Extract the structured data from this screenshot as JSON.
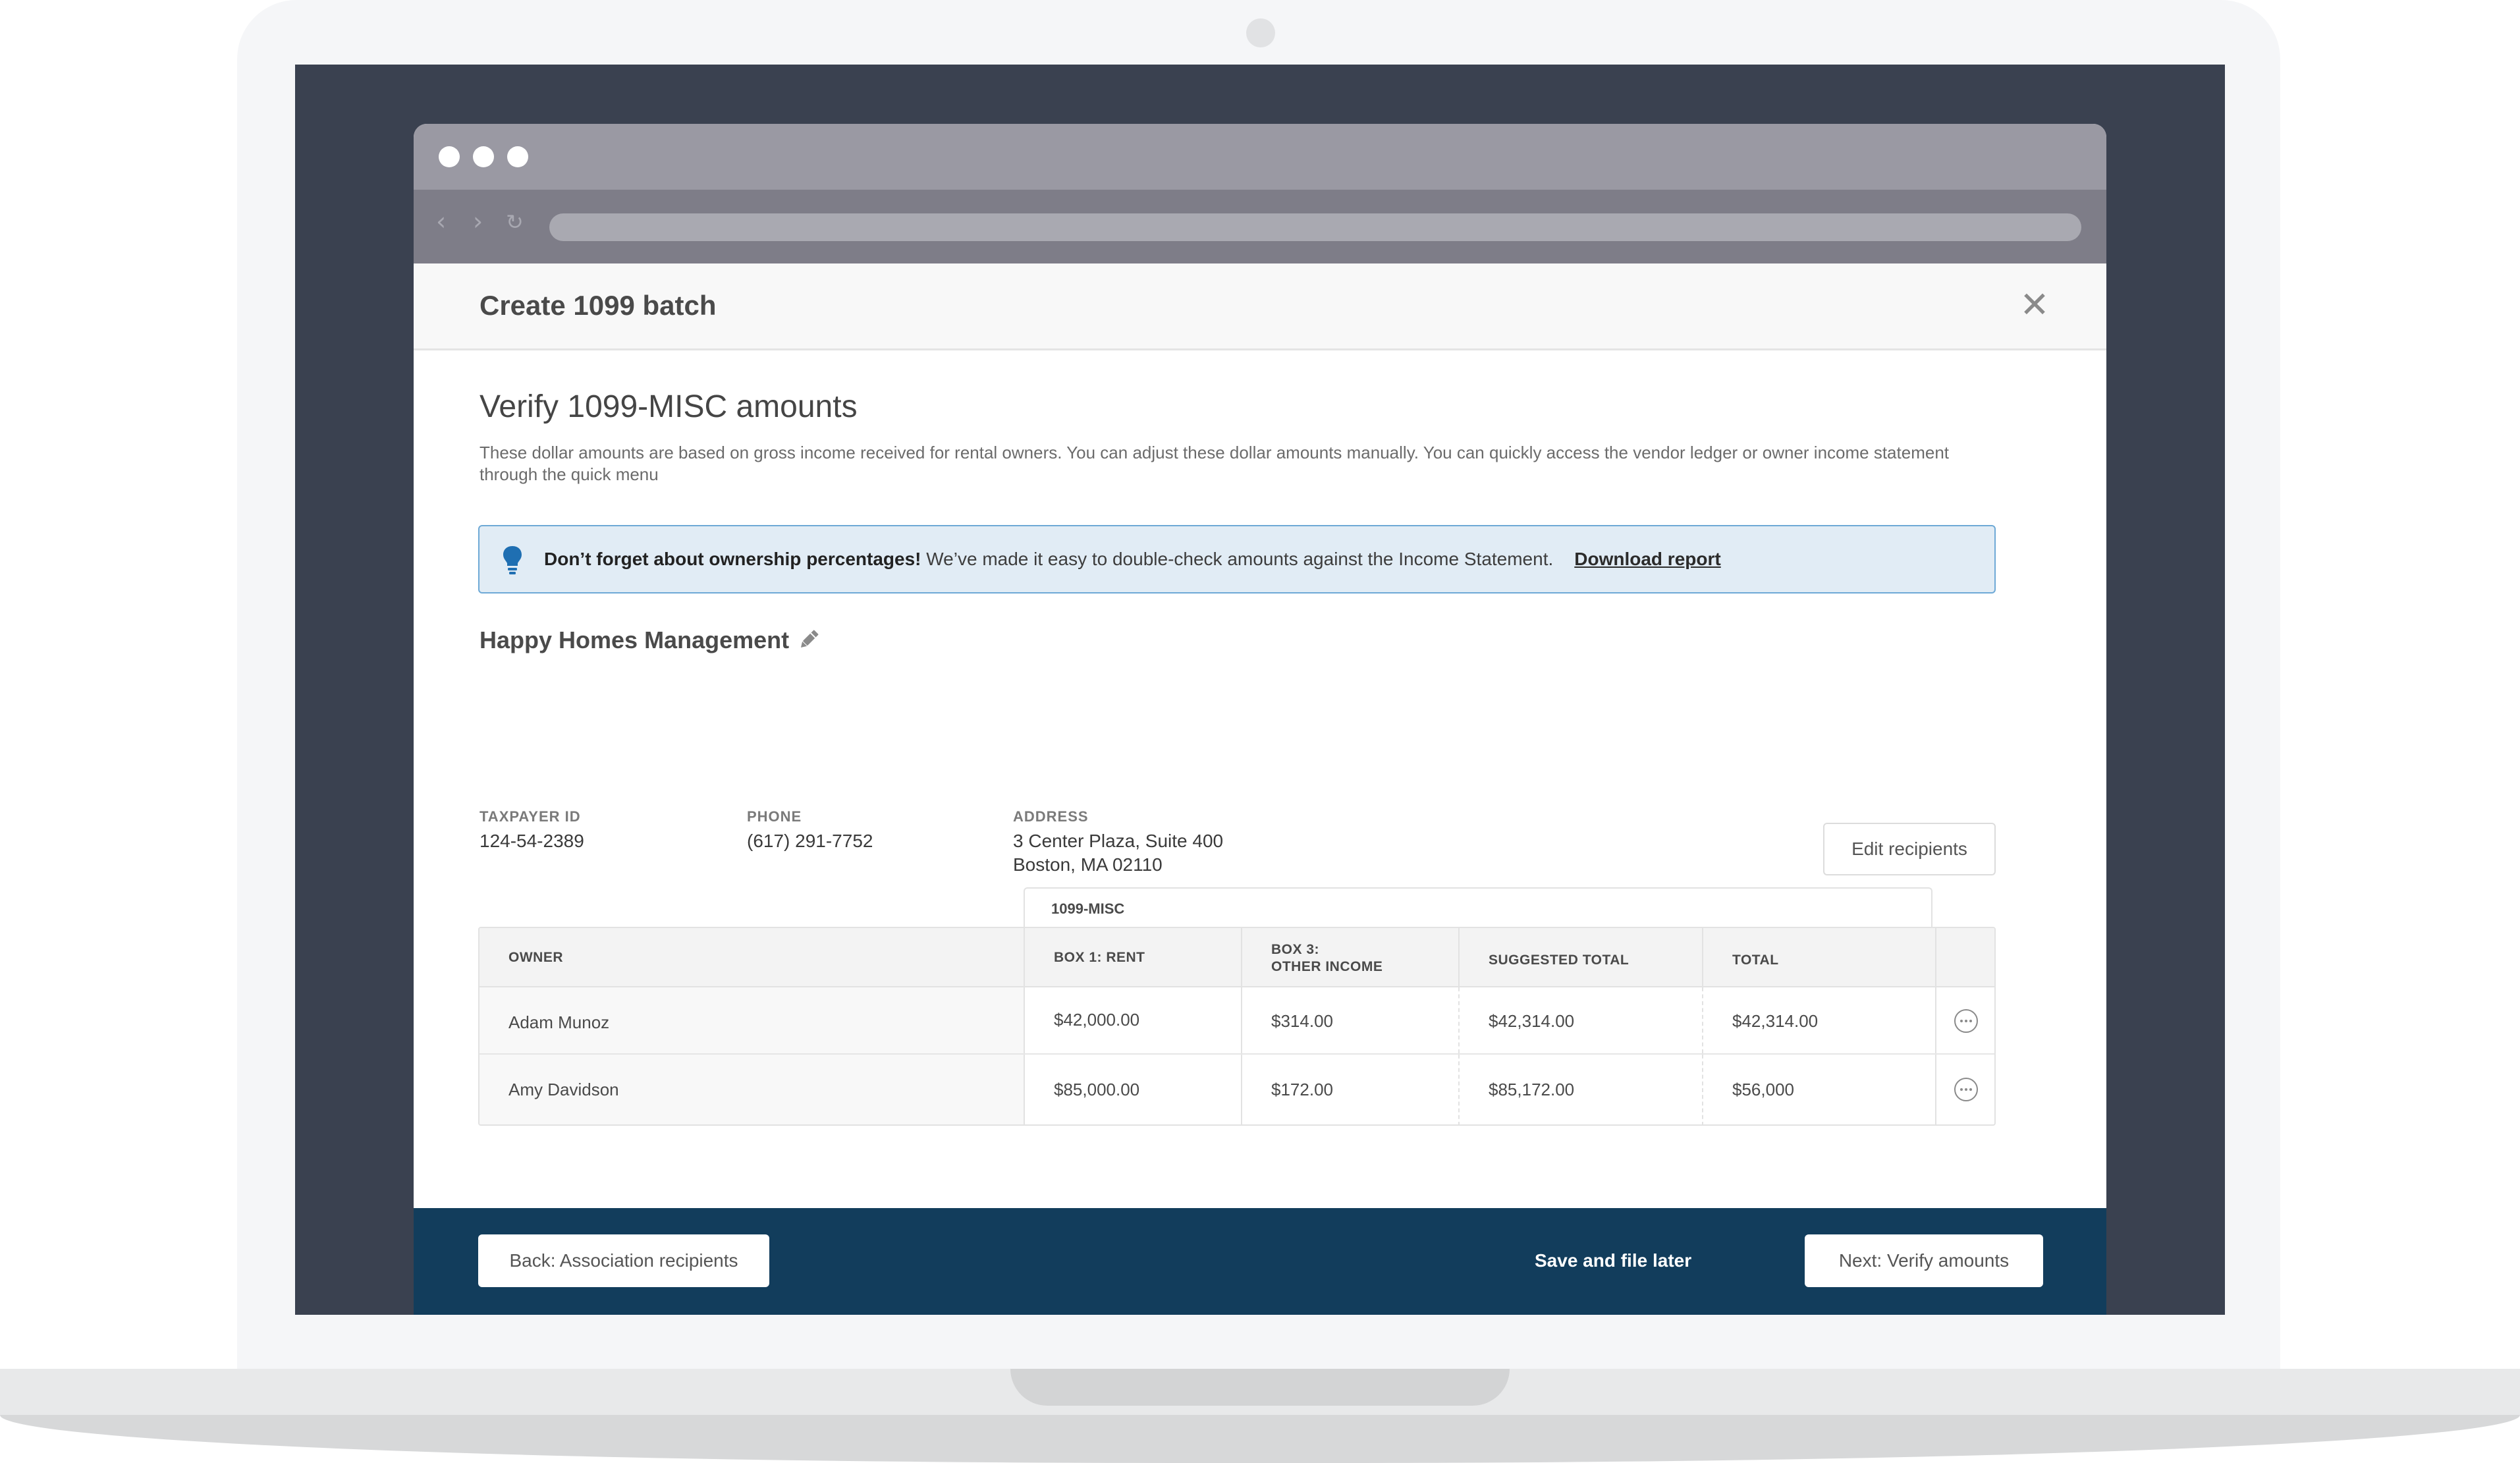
{
  "modal": {
    "title": "Create 1099 batch",
    "close_label": "✕"
  },
  "section": {
    "title": "Verify 1099-MISC amounts",
    "description": "These dollar amounts are based on gross income received for rental owners. You can adjust these dollar amounts manually. You can quickly access the vendor ledger or owner income statement through the quick menu"
  },
  "tip": {
    "bold": "Don’t forget about ownership percentages!",
    "text": " We’ve made it easy to double-check amounts against the Income Statement.",
    "link": "Download report"
  },
  "company": {
    "name": "Happy Homes Management",
    "taxpayer_label": "TAXPAYER ID",
    "taxpayer_id": "124-54-2389",
    "phone_label": "PHONE",
    "phone": "(617) 291-7752",
    "address_label": "ADDRESS",
    "address_line1": "3 Center Plaza, Suite 400",
    "address_line2": "Boston, MA 02110",
    "edit_label": "Edit recipients"
  },
  "table": {
    "group_label": "1099-MISC",
    "headers": {
      "owner": "OWNER",
      "box1": "BOX 1: RENT",
      "box3_line1": "BOX 3:",
      "box3_line2": "OTHER INCOME",
      "suggested": "SUGGESTED TOTAL",
      "total": "TOTAL"
    },
    "rows": [
      {
        "owner": "Adam Munoz",
        "box1": "$42,000.00",
        "box3": "$314.00",
        "suggested": "$42,314.00",
        "total": "$42,314.00"
      },
      {
        "owner": "Amy Davidson",
        "box1": "$85,000.00",
        "box3": "$172.00",
        "suggested": "$85,172.00",
        "total": "$56,000"
      }
    ]
  },
  "footer": {
    "back_label": "Back: Association recipients",
    "save_label": "Save and file later",
    "next_label": "Next: Verify amounts"
  },
  "nav": {
    "back_glyph": "‹",
    "forward_glyph": "›",
    "reload_glyph": "↻"
  },
  "colors": {
    "footer_bg": "#123d5c",
    "tip_bg": "#e1ecf5",
    "tip_border": "#6ea9d6",
    "bulb": "#1f6fb2"
  }
}
